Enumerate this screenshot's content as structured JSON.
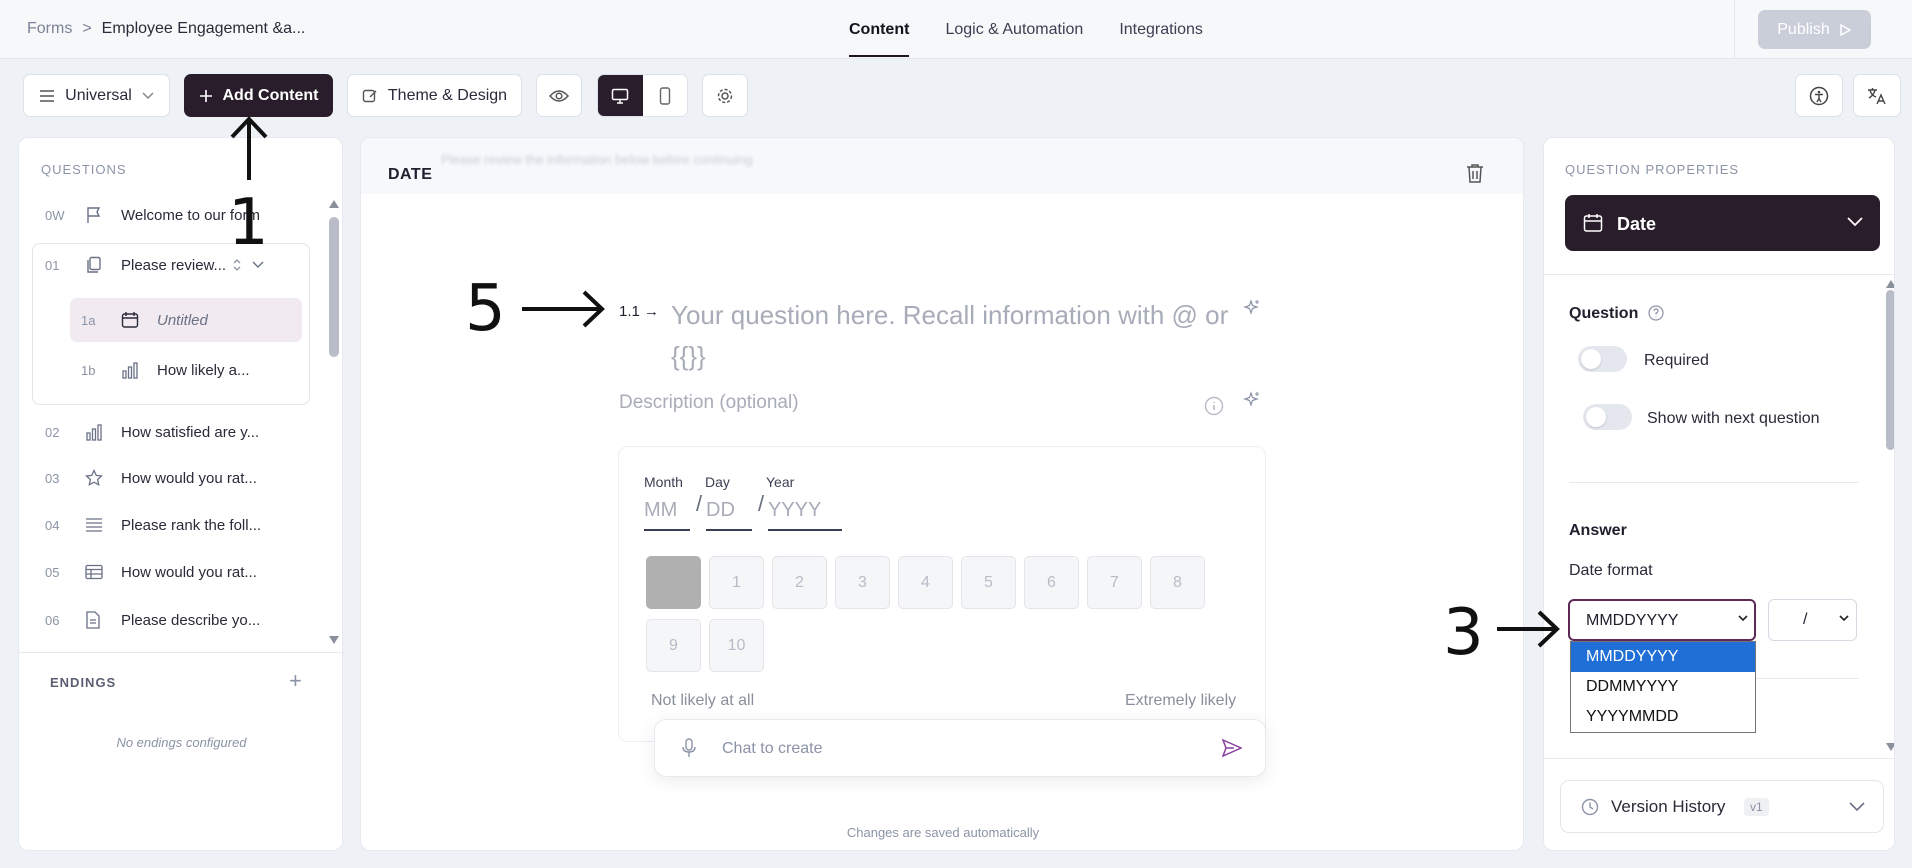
{
  "breadcrumb": {
    "root": "Forms",
    "separator": ">",
    "current": "Employee Engagement &a..."
  },
  "tabs": [
    {
      "label": "Content"
    },
    {
      "label": "Logic & Automation"
    },
    {
      "label": "Integrations"
    }
  ],
  "publish_label": "Publish",
  "toolbar": {
    "mode_label": "Universal",
    "add_content_label": "Add Content",
    "theme_label": "Theme & Design"
  },
  "questions_panel": {
    "heading": "QUESTIONS",
    "items": [
      {
        "num": "0W",
        "label": "Welcome to our form",
        "icon": "flag-icon"
      },
      {
        "num": "01",
        "label": "Please review...",
        "icon": "pages-icon"
      },
      {
        "num": "1a",
        "label": "Untitled",
        "icon": "calendar-icon"
      },
      {
        "num": "1b",
        "label": "How likely a...",
        "icon": "bar-chart-icon"
      },
      {
        "num": "02",
        "label": "How satisfied are y...",
        "icon": "bar-chart-icon"
      },
      {
        "num": "03",
        "label": "How would you rat...",
        "icon": "star-icon"
      },
      {
        "num": "04",
        "label": "Please rank the foll...",
        "icon": "list-icon"
      },
      {
        "num": "05",
        "label": "How would you rat...",
        "icon": "table-icon"
      },
      {
        "num": "06",
        "label": "Please describe yo...",
        "icon": "document-icon"
      }
    ],
    "endings_heading": "ENDINGS",
    "endings_add": "+",
    "no_endings": "No endings configured"
  },
  "editor": {
    "header": "DATE",
    "ghost_text": "Please review the information below before continuing",
    "question_number": "1.1 →",
    "question_placeholder": "Your question here. Recall information with @ or {{}}",
    "description_placeholder": "Description (optional)",
    "date_labels": {
      "month": "Month",
      "day": "Day",
      "year": "Year"
    },
    "date_placeholders": {
      "month": "MM",
      "day": "DD",
      "year": "YYYY"
    },
    "date_separator": "/",
    "scale": [
      "1",
      "2",
      "3",
      "4",
      "5",
      "6",
      "7",
      "8",
      "9",
      "10"
    ],
    "scale_low": "Not likely at all",
    "scale_high": "Extremely likely",
    "chat_placeholder": "Chat to create",
    "saved_note": "Changes are saved automatically"
  },
  "properties": {
    "heading": "QUESTION PROPERTIES",
    "type_label": "Date",
    "question_section": "Question",
    "required_label": "Required",
    "show_next_label": "Show with next question",
    "answer_section": "Answer",
    "date_format_label": "Date format",
    "date_format_value": "MMDDYYYY",
    "separator_value": "/",
    "date_format_options": [
      "MMDDYYYY",
      "DDMMYYYY",
      "YYYYMMDD"
    ],
    "version_history_label": "Version History",
    "version_badge": "v1"
  },
  "annotations": {
    "a1": "1",
    "a3": "3",
    "a5": "5"
  },
  "colors": {
    "accent_dark": "#2a1d2b",
    "select_highlight": "#1f6fd6",
    "focus_border": "#5c2a55"
  }
}
